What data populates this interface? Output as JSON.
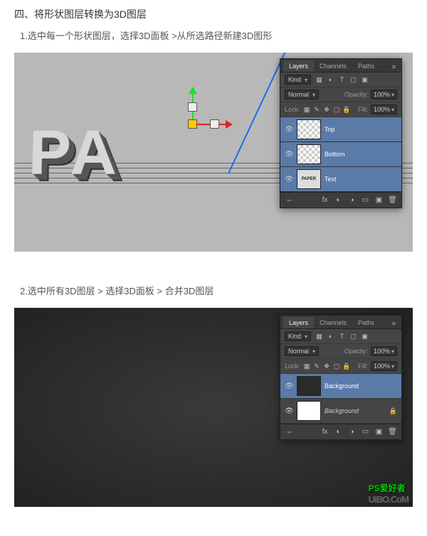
{
  "heading": "四、将形状图层转换为3D图层",
  "step1": "1.选中每一个形状图层，选择3D面板 >从所选路径新建3D图形",
  "step2": "2.选中所有3D图层 > 选择3D面板 > 合并3D图层",
  "panel": {
    "tabs": {
      "layers": "Layers",
      "channels": "Channels",
      "paths": "Paths"
    },
    "kind_label": "Kind",
    "blend_mode": "Normal",
    "opacity_label": "Opacity:",
    "opacity_value": "100%",
    "lock_label": "Lock:",
    "fill_label": "Fill:",
    "fill_value": "100%"
  },
  "layers1": [
    {
      "name": "Top",
      "thumb": "checker"
    },
    {
      "name": "Bottom",
      "thumb": "checker"
    },
    {
      "name": "Text",
      "thumb": "paper"
    }
  ],
  "layers2": [
    {
      "name": "Background",
      "thumb": "dark",
      "link": true
    },
    {
      "name": "Background",
      "thumb": "white",
      "italic": true,
      "locked": true
    }
  ],
  "paper_thumb_text": "PAPER",
  "watermark": {
    "a": "PS",
    "b": "爱好者",
    "c": "UiBO.CoM"
  }
}
